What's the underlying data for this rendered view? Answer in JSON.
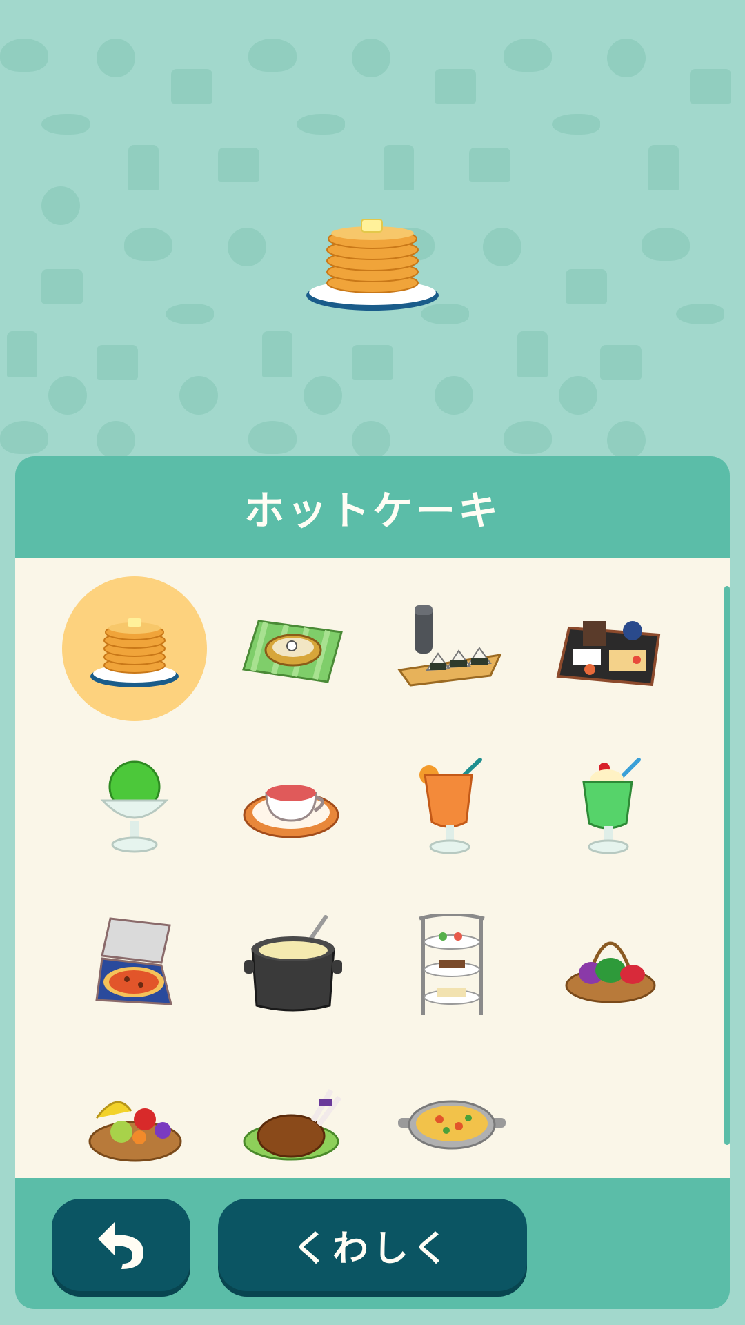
{
  "panel": {
    "title": "ホットケーキ",
    "selected_index": 0,
    "items": [
      {
        "icon": "pancakes-icon"
      },
      {
        "icon": "bento-box-icon"
      },
      {
        "icon": "onigiri-thermos-icon"
      },
      {
        "icon": "japanese-set-meal-icon"
      },
      {
        "icon": "shaved-ice-icon"
      },
      {
        "icon": "tea-cup-icon"
      },
      {
        "icon": "orange-juice-icon"
      },
      {
        "icon": "melon-float-icon"
      },
      {
        "icon": "pizza-box-icon"
      },
      {
        "icon": "soup-pot-icon"
      },
      {
        "icon": "afternoon-tea-stand-icon"
      },
      {
        "icon": "vegetable-basket-icon"
      },
      {
        "icon": "fruit-basket-icon"
      },
      {
        "icon": "roast-chicken-icon"
      },
      {
        "icon": "paella-icon"
      }
    ]
  },
  "buttons": {
    "back_icon": "back-arrow-icon",
    "detail_label": "くわしく"
  },
  "featured": {
    "icon": "pancakes-icon"
  },
  "colors": {
    "background": "#a2d8cc",
    "panel": "#5bbda8",
    "grid_bg": "#faf6e8",
    "selection": "#fdd27e",
    "button": "#0b5563"
  }
}
